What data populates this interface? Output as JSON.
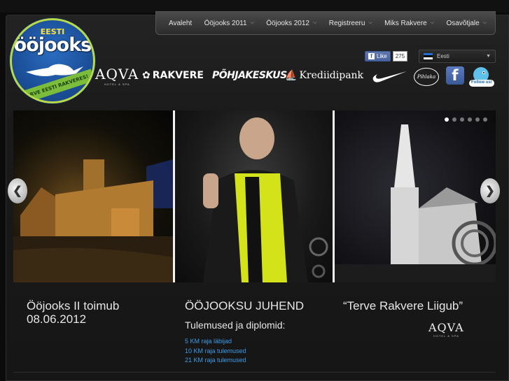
{
  "nav": {
    "items": [
      {
        "label": "Avaleht",
        "has_dropdown": false
      },
      {
        "label": "Ööjooks 2011",
        "has_dropdown": true
      },
      {
        "label": "Ööjooks 2012",
        "has_dropdown": true
      },
      {
        "label": "Registreeru",
        "has_dropdown": true
      },
      {
        "label": "Miks Rakvere",
        "has_dropdown": true
      },
      {
        "label": "Osavõtjale",
        "has_dropdown": true
      }
    ]
  },
  "logo": {
    "top_text": "EESTI",
    "title": "ööjooks",
    "banner": "TERVE EESTI RAKVERES!"
  },
  "facebook_like": {
    "label": "Like",
    "count": "275"
  },
  "language": {
    "selected": "Eesti"
  },
  "sponsors": {
    "aqva": "AQVA",
    "aqva_sub": "HOTEL & SPA",
    "rakvere": "RAKVERE",
    "pohjakeskus": "PÕHJAKESKUS",
    "krediidipank": "Krediidipank",
    "pihlaka": "Pihlaka",
    "facebook": "f",
    "twitter": "Follow us!"
  },
  "slider": {
    "dot_count": 6,
    "active_dot": 0
  },
  "columns": {
    "col1_title": "Ööjooks II toimub 08.06.2012",
    "col2_title": "ÖÖJOOKSU JUHEND",
    "col2_subtitle": "Tulemused ja diplomid:",
    "col2_links": [
      "5 KM raja läbijad",
      "10 KM raja tulemused",
      "21 KM raja tulemused"
    ],
    "col3_title": "“Terve Rakvere Liigub”",
    "col3_logo": "AQVA",
    "col3_logo_sub": "HOTEL & SPA"
  },
  "colors": {
    "accent_link": "#3d9ce8",
    "logo_ring": "#b9d84a",
    "logo_blue": "#1b4f98"
  }
}
